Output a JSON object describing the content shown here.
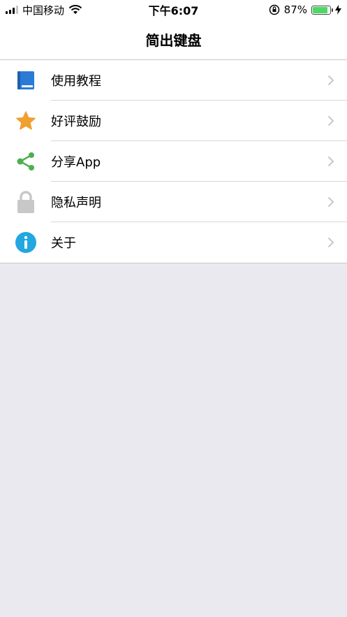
{
  "status_bar": {
    "carrier": "中国移动",
    "time": "下午6:07",
    "battery_percent": "87%",
    "battery_level": 0.87,
    "battery_color": "#4cd964"
  },
  "nav": {
    "title": "简出键盘"
  },
  "menu": [
    {
      "label": "使用教程",
      "icon": "book-icon",
      "icon_color": "#2a7ad6"
    },
    {
      "label": "好评鼓励",
      "icon": "star-icon",
      "icon_color": "#f0a030"
    },
    {
      "label": "分享App",
      "icon": "share-icon",
      "icon_color": "#4caf50"
    },
    {
      "label": "隐私声明",
      "icon": "lock-icon",
      "icon_color": "#c8c8c8"
    },
    {
      "label": "关于",
      "icon": "info-icon",
      "icon_color": "#22a7e0"
    }
  ]
}
